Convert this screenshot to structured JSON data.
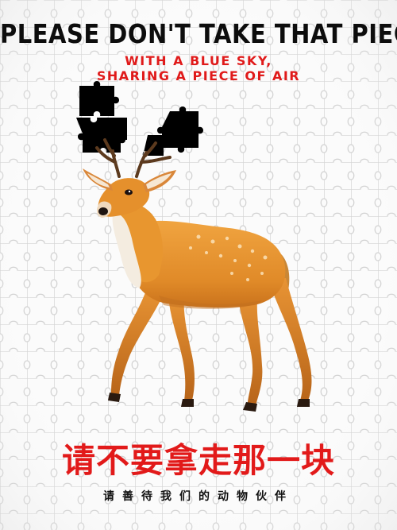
{
  "poster": {
    "headline": "PLEASE DON'T TAKE THAT PIECE",
    "subline_1": "WITH A BLUE SKY,",
    "subline_2": "SHARING A PIECE OF AIR",
    "title_cn": "请不要拿走那一块",
    "subtitle_cn": "请善待我们的动物伙伴"
  },
  "colors": {
    "headline": "#0d0d0d",
    "accent_red": "#e01a1a",
    "deer_body": "#e8932e",
    "puzzle_line": "#d4d4d4",
    "missing_piece": "#000000"
  },
  "icons": {
    "background": "jigsaw-puzzle-grid",
    "missing_pieces": "black-puzzle-pieces",
    "subject": "deer-illustration"
  }
}
